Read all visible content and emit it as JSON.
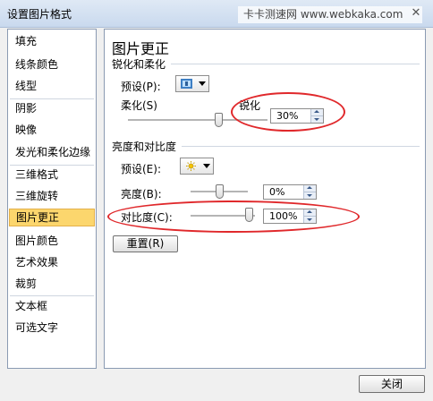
{
  "window": {
    "title": "设置图片格式",
    "close_glyph": "✕"
  },
  "watermark": "卡卡测速网 www.webkaka.com",
  "sidebar": {
    "items": [
      {
        "label": "填充"
      },
      {
        "label": "线条颜色"
      },
      {
        "label": "线型"
      },
      {
        "label": "阴影"
      },
      {
        "label": "映像"
      },
      {
        "label": "发光和柔化边缘"
      },
      {
        "label": "三维格式"
      },
      {
        "label": "三维旋转"
      },
      {
        "label": "图片更正",
        "active": true
      },
      {
        "label": "图片颜色"
      },
      {
        "label": "艺术效果"
      },
      {
        "label": "裁剪"
      },
      {
        "label": "文本框"
      },
      {
        "label": "可选文字"
      }
    ]
  },
  "main": {
    "heading": "图片更正",
    "sharpen_group": {
      "title": "锐化和柔化",
      "preset_label": "预设(P):",
      "preset_icon": "sharpen-preset-icon",
      "soften_label": "柔化(S)",
      "sharpen_label": "锐化",
      "value": "30%",
      "slider_fraction": 0.65
    },
    "brightness_group": {
      "title": "亮度和对比度",
      "preset_label": "预设(E):",
      "preset_icon": "sun-icon",
      "brightness_label": "亮度(B):",
      "brightness_value": "0%",
      "brightness_fraction": 0.5,
      "contrast_label": "对比度(C):",
      "contrast_value": "100%",
      "contrast_fraction": 0.9
    },
    "reset_label": "重置(R)"
  },
  "footer": {
    "close_label": "关闭"
  },
  "colors": {
    "highlight": "#fcd66d",
    "annotation": "#e0282b"
  }
}
